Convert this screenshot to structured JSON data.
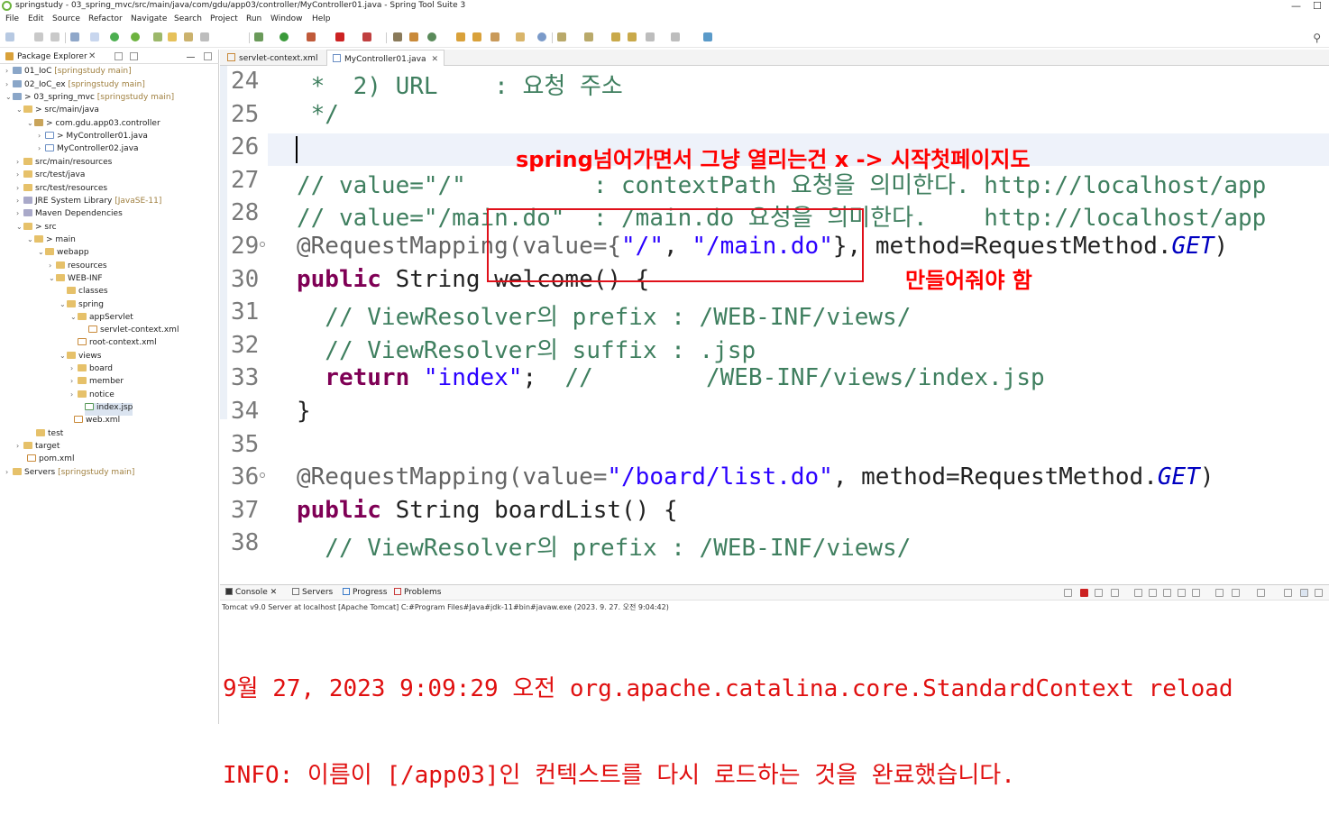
{
  "window": {
    "title": "springstudy - 03_spring_mvc/src/main/java/com/gdu/app03/controller/MyController01.java - Spring Tool Suite 3",
    "minimize": "—",
    "maximize": "☐"
  },
  "menu": [
    "File",
    "Edit",
    "Source",
    "Refactor",
    "Navigate",
    "Search",
    "Project",
    "Run",
    "Window",
    "Help"
  ],
  "explorer": {
    "title": "Package Explorer",
    "close": "✕",
    "tree": [
      {
        "label": "01_IoC",
        "dec": "[springstudy main]"
      },
      {
        "label": "02_IoC_ex",
        "dec": "[springstudy main]"
      },
      {
        "label": "> 03_spring_mvc",
        "dec": "[springstudy main]"
      },
      {
        "label": "> src/main/java",
        "dec": ""
      },
      {
        "label": "> com.gdu.app03.controller",
        "dec": ""
      },
      {
        "label": "> MyController01.java",
        "dec": ""
      },
      {
        "label": "MyController02.java",
        "dec": ""
      },
      {
        "label": "src/main/resources",
        "dec": ""
      },
      {
        "label": "src/test/java",
        "dec": ""
      },
      {
        "label": "src/test/resources",
        "dec": ""
      },
      {
        "label": "JRE System Library",
        "dec": "[JavaSE-11]"
      },
      {
        "label": "Maven Dependencies",
        "dec": ""
      },
      {
        "label": "> src",
        "dec": ""
      },
      {
        "label": "> main",
        "dec": ""
      },
      {
        "label": "webapp",
        "dec": ""
      },
      {
        "label": "resources",
        "dec": ""
      },
      {
        "label": "WEB-INF",
        "dec": ""
      },
      {
        "label": "classes",
        "dec": ""
      },
      {
        "label": "spring",
        "dec": ""
      },
      {
        "label": "appServlet",
        "dec": ""
      },
      {
        "label": "servlet-context.xml",
        "dec": ""
      },
      {
        "label": "root-context.xml",
        "dec": ""
      },
      {
        "label": "views",
        "dec": ""
      },
      {
        "label": "board",
        "dec": ""
      },
      {
        "label": "member",
        "dec": ""
      },
      {
        "label": "notice",
        "dec": ""
      },
      {
        "label": "index.jsp",
        "dec": ""
      },
      {
        "label": "web.xml",
        "dec": ""
      },
      {
        "label": "test",
        "dec": ""
      },
      {
        "label": "target",
        "dec": ""
      },
      {
        "label": "pom.xml",
        "dec": ""
      },
      {
        "label": "Servers",
        "dec": "[springstudy main]"
      }
    ]
  },
  "editor": {
    "tabs": [
      {
        "label": "servlet-context.xml"
      },
      {
        "label": "MyController01.java",
        "close": "✕"
      }
    ],
    "lines": [
      {
        "n": "24",
        "code": " *  2) URL    : 요청 주소"
      },
      {
        "n": "25",
        "code": " */"
      },
      {
        "n": "26",
        "code": ""
      },
      {
        "n": "27",
        "code": "// value=\"/\"         : contextPath 요청을 의미한다. http://localhost/app"
      },
      {
        "n": "28",
        "code": "// value=\"/main.do\"  : /main.do 요청을 의미한다.    http://localhost/app"
      },
      {
        "n": "29",
        "pre": "@RequestMapping(value={",
        "s1": "\"/\"",
        "mid": ", ",
        "s2": "\"/main.do\"",
        "post": "}, method=RequestMethod.",
        "it": "GET",
        "end": ")"
      },
      {
        "n": "30",
        "kw": "public",
        "rest": " String welcome() {"
      },
      {
        "n": "31",
        "code": "  // ViewResolver의 prefix : /WEB-INF/views/"
      },
      {
        "n": "32",
        "code": "  // ViewResolver의 suffix : .jsp"
      },
      {
        "n": "33",
        "kw": "  return",
        "sp": " ",
        "str": "\"index\"",
        "semi": ";  ",
        "cmt": "//        /WEB-INF/views/index.jsp"
      },
      {
        "n": "34",
        "code": "}"
      },
      {
        "n": "35",
        "code": ""
      },
      {
        "n": "36",
        "pre": "@RequestMapping(value=",
        "s1": "\"/board/list.do\"",
        "post": ", method=RequestMethod.",
        "it": "GET",
        "end": ")"
      },
      {
        "n": "37",
        "kw": "public",
        "rest": " String boardList() {"
      },
      {
        "n": "38",
        "code": "  // ViewResolver의 prefix : /WEB-INF/views/"
      }
    ],
    "annotation_top": "spring넘어가면서 그냥 열리는건 x -> 시작첫페이지도",
    "annotation_bottom": "만들어줘야 함",
    "scroll_left": "<"
  },
  "console": {
    "tabs": [
      {
        "label": "Console",
        "close": "✕"
      },
      {
        "label": "Servers"
      },
      {
        "label": "Progress"
      },
      {
        "label": "Problems"
      }
    ],
    "description": "Tomcat v9.0 Server at localhost [Apache Tomcat] C:#Program Files#Java#jdk-11#bin#javaw.exe  (2023. 9. 27. 오전 9:04:42)",
    "output": [
      "9월 27, 2023 9:09:29 오전 org.apache.catalina.core.StandardContext reload",
      "INFO: 이름이 [/app03]인 컨텍스트를 다시 로드하는 것을 완료했습니다."
    ]
  }
}
